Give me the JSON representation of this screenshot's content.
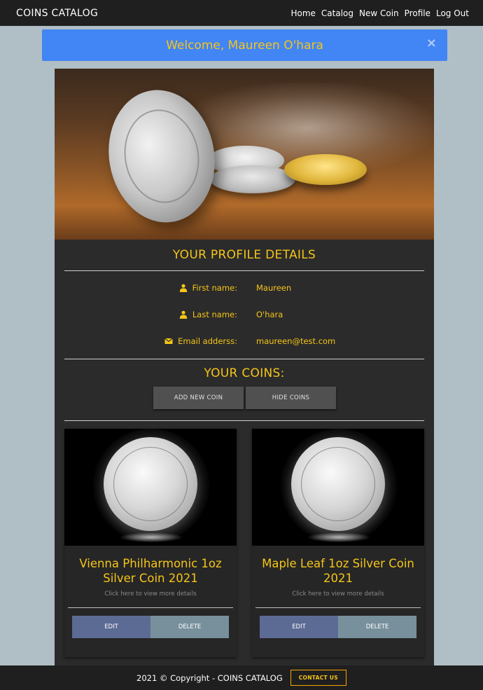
{
  "navbar": {
    "brand": "COINS CATALOG",
    "links": [
      "Home",
      "Catalog",
      "New Coin",
      "Profile",
      "Log Out"
    ]
  },
  "alert": {
    "message": "Welcome, Maureen O'hara",
    "close_symbol": "×"
  },
  "profile": {
    "title": "YOUR PROFILE DETAILS",
    "fields": [
      {
        "icon": "user-icon",
        "label": "First name:",
        "value": "Maureen"
      },
      {
        "icon": "user-icon",
        "label": "Last name:",
        "value": "O'hara"
      },
      {
        "icon": "envelope-icon",
        "label": "Email adderss:",
        "value": "maureen@test.com"
      }
    ]
  },
  "coins_section": {
    "title": "YOUR COINS:",
    "add_button": "ADD NEW COIN",
    "hide_button": "HIDE COINS"
  },
  "coins": [
    {
      "name": "Vienna Philharmonic 1oz Silver Coin 2021",
      "subtitle": "Click here to view more details",
      "edit": "EDIT",
      "delete": "DELETE"
    },
    {
      "name": "Maple Leaf 1oz Silver Coin 2021",
      "subtitle": "Click here to view more details",
      "edit": "EDIT",
      "delete": "DELETE"
    }
  ],
  "footer": {
    "copyright": "2021 © Copyright -  COINS CATALOG",
    "contact_button": "CONTACT US"
  },
  "colors": {
    "accent": "#f5c518",
    "alert_bg": "#4285f4",
    "page_bg": "#b0bec5",
    "card_bg": "#2b2b2b",
    "edit_btn": "#5c6b93",
    "delete_btn": "#78909c"
  }
}
